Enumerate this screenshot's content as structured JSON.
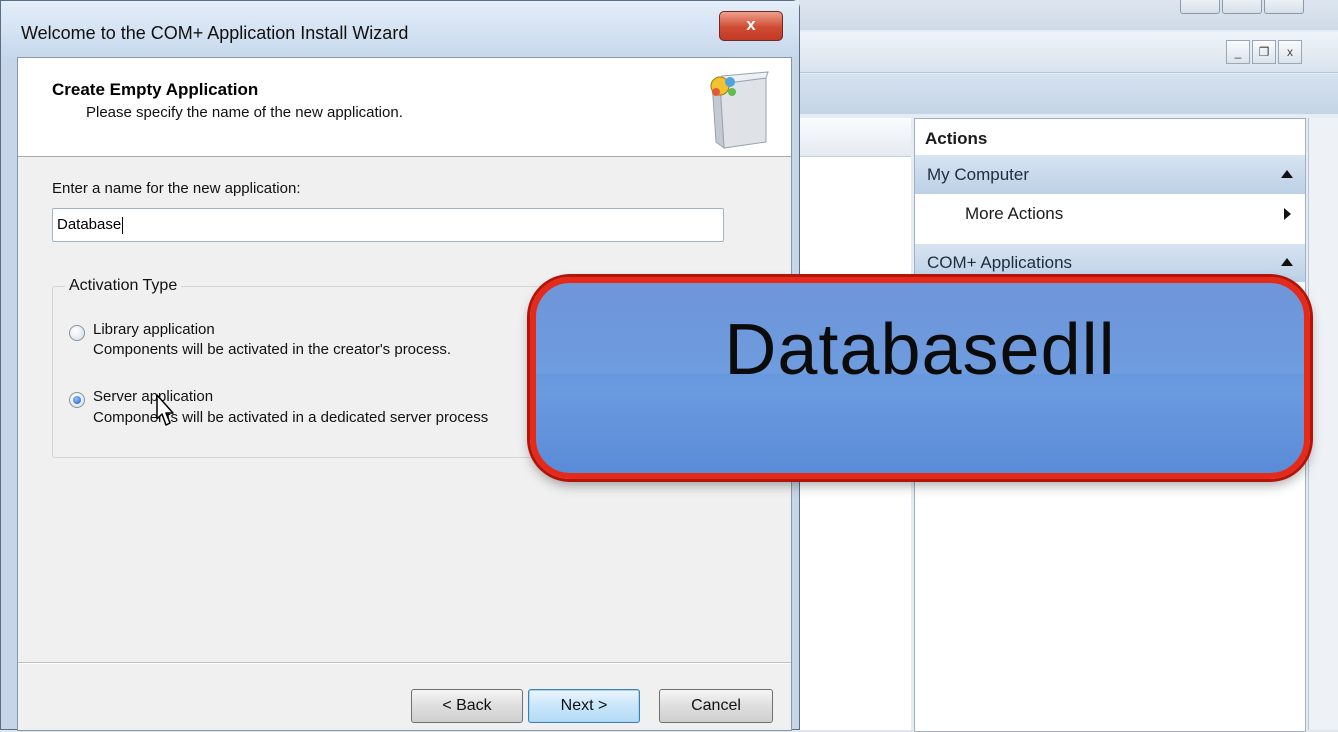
{
  "wizard": {
    "title": "Welcome to the COM+ Application Install Wizard",
    "close_label": "x",
    "header_title": "Create Empty Application",
    "header_subtitle": "Please specify the name of the new application.",
    "name_label": "Enter a name for the new application:",
    "name_value": "Database",
    "activation_group_label": "Activation Type",
    "options": [
      {
        "title": "Library application",
        "description": "Components will be activated in the creator's process.",
        "selected": false
      },
      {
        "title": "Server application",
        "description": "Components will be activated in a dedicated server process",
        "selected": true
      }
    ],
    "buttons": {
      "back": "< Back",
      "next": "Next >",
      "cancel": "Cancel"
    }
  },
  "mmc": {
    "mdi_buttons": [
      "_",
      "❐",
      "x"
    ],
    "actions": {
      "title": "Actions",
      "sections": [
        {
          "label": "My Computer",
          "items": [
            "More Actions"
          ]
        },
        {
          "label": "COM+ Applications",
          "items": []
        }
      ]
    }
  },
  "callout": {
    "text": "Databasedll",
    "border_color": "#e52a1a",
    "fill_color": "#5a8bd6"
  }
}
